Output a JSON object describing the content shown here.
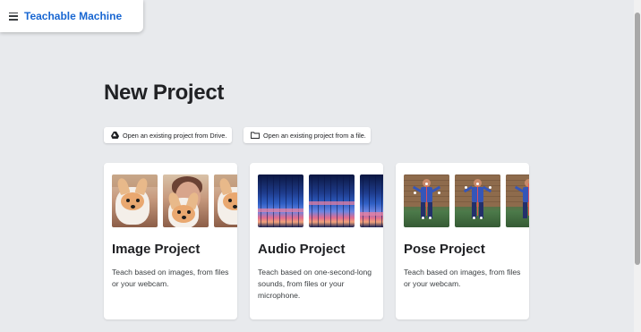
{
  "header": {
    "brand": "Teachable Machine",
    "menu_icon": "hamburger-menu-icon",
    "brand_color": "#1967d2"
  },
  "main": {
    "title": "New Project",
    "open_drive": {
      "label": "Open an existing project from Drive.",
      "icon": "google-drive-icon"
    },
    "open_file": {
      "label": "Open an existing project from a file.",
      "icon": "folder-icon"
    }
  },
  "projects": [
    {
      "title": "Image Project",
      "description": "Teach based on images, from files or your webcam."
    },
    {
      "title": "Audio Project",
      "description": "Teach based on one-second-long sounds, from files or your microphone."
    },
    {
      "title": "Pose Project",
      "description": "Teach based on images, from files or your webcam."
    }
  ],
  "colors": {
    "background": "#e8eaed",
    "card": "#ffffff",
    "text": "#202124"
  }
}
